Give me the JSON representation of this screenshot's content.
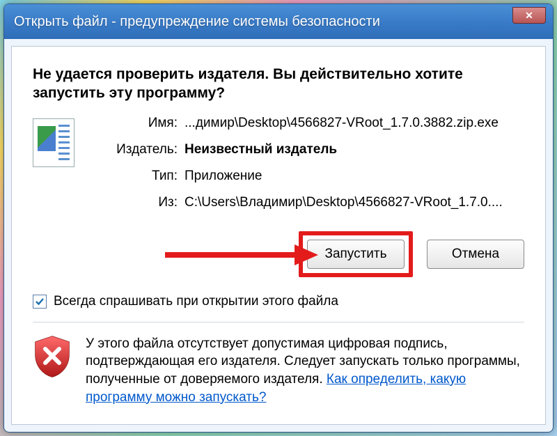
{
  "titlebar": {
    "title": "Открыть файл - предупреждение системы безопасности"
  },
  "heading": "Не удается проверить издателя.  Вы действительно хотите запустить эту программу?",
  "info": {
    "name_label": "Имя:",
    "name_value": "...димир\\Desktop\\4566827-VRoot_1.7.0.3882.zip.exe",
    "publisher_label": "Издатель:",
    "publisher_value": "Неизвестный издатель",
    "type_label": "Тип:",
    "type_value": "Приложение",
    "from_label": "Из:",
    "from_value": "C:\\Users\\Владимир\\Desktop\\4566827-VRoot_1.7.0...."
  },
  "buttons": {
    "run": "Запустить",
    "cancel": "Отмена"
  },
  "checkbox": {
    "checked": true,
    "label": "Всегда спрашивать при открытии этого файла"
  },
  "warning": {
    "text": "У этого файла отсутствует допустимая цифровая подпись, подтверждающая его издателя.  Следует запускать только программы, полученные от доверяемого издателя.  ",
    "link": "Как определить, какую программу можно запускать?"
  },
  "colors": {
    "highlight": "#e31b1b",
    "link": "#0058cc"
  }
}
